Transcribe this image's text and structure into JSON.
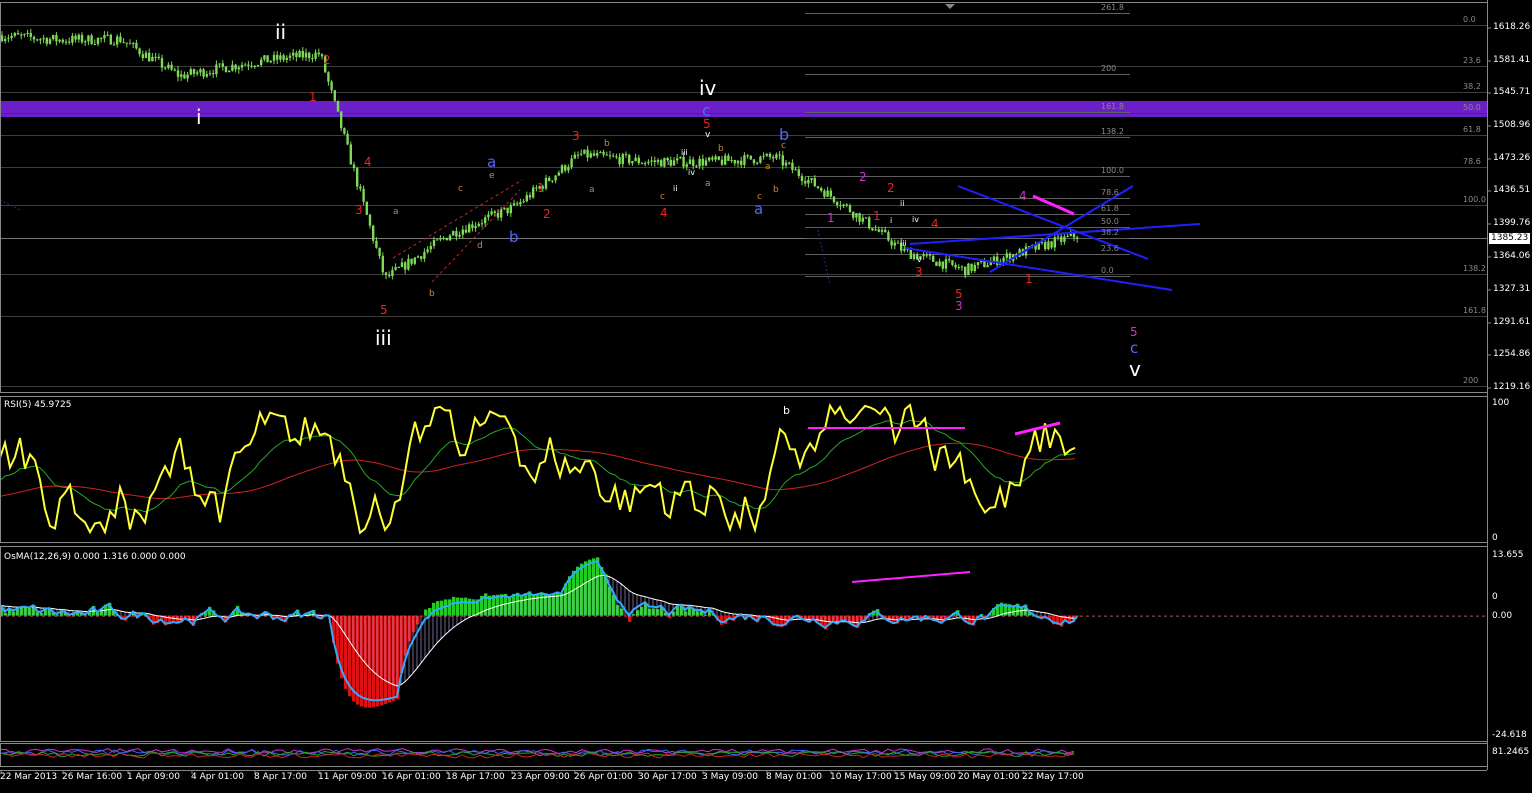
{
  "colors": {
    "background": "#000000",
    "grid": "#3a3a3a",
    "candle": "#7ed957",
    "purple_band": "#6a1fc9",
    "fib": "#606060",
    "trend": "#2020ff",
    "rsi": "#ffff33",
    "rsi_ma_fast": "#22aa22",
    "rsi_ma_slow": "#cc2222",
    "osma_pos": "#22cc22",
    "osma_neg": "#dd1111",
    "osma_line": "#33aaff",
    "osma_signal": "#ffffff",
    "divergence": "#ff22ff",
    "wave_red": "#ee2222",
    "wave_orange": "#cc8833",
    "wave_blue": "#5566ff",
    "wave_magenta": "#cc33cc",
    "wave_white": "#ffffff"
  },
  "price_panel": {
    "current_price": "1385.23",
    "y_ticks": [
      "1618.26",
      "1581.41",
      "1545.71",
      "1508.96",
      "1473.26",
      "1436.51",
      "1399.76",
      "1364.06",
      "1327.31",
      "1291.61",
      "1254.86",
      "1219.16"
    ],
    "fib_labels_right": [
      "0.0",
      "23.6",
      "38.2",
      "50.0",
      "61.8",
      "78.6",
      "100.0",
      "138.2",
      "161.8",
      "200"
    ],
    "fib_labels_inner": [
      "261.8",
      "200",
      "161.8",
      "138.2",
      "100.0",
      "78.6",
      "61.8",
      "50.0",
      "38.2",
      "23.6",
      "0.0"
    ],
    "wave_labels": [
      {
        "t": "ii",
        "c": "white"
      },
      {
        "t": "i",
        "c": "white"
      },
      {
        "t": "2",
        "c": "red"
      },
      {
        "t": "1",
        "c": "red"
      },
      {
        "t": "4",
        "c": "red"
      },
      {
        "t": "3",
        "c": "red"
      },
      {
        "t": "5",
        "c": "red"
      },
      {
        "t": "iii",
        "c": "white"
      },
      {
        "t": "a",
        "c": "blue"
      },
      {
        "t": "b",
        "c": "blue"
      },
      {
        "t": "c",
        "c": "orange"
      },
      {
        "t": "e",
        "c": "orange"
      },
      {
        "t": "d",
        "c": "orange"
      },
      {
        "t": "b",
        "c": "orange"
      },
      {
        "t": "a",
        "c": "orange"
      },
      {
        "t": "1",
        "c": "red"
      },
      {
        "t": "2",
        "c": "red"
      },
      {
        "t": "3",
        "c": "red"
      },
      {
        "t": "b",
        "c": "orange"
      },
      {
        "t": "a",
        "c": "orange"
      },
      {
        "t": "c",
        "c": "orange"
      },
      {
        "t": "4",
        "c": "red"
      },
      {
        "t": "iv",
        "c": "white"
      },
      {
        "t": "c",
        "c": "blue"
      },
      {
        "t": "5",
        "c": "red"
      },
      {
        "t": "v",
        "c": "white"
      },
      {
        "t": "b",
        "c": "orange"
      },
      {
        "t": "a",
        "c": "orange"
      },
      {
        "t": "iii",
        "c": "white"
      },
      {
        "t": "i",
        "c": "white"
      },
      {
        "t": "ii",
        "c": "white"
      },
      {
        "t": "iv",
        "c": "white"
      },
      {
        "t": "b",
        "c": "blue"
      },
      {
        "t": "c",
        "c": "orange"
      },
      {
        "t": "a",
        "c": "orange"
      },
      {
        "t": "b",
        "c": "orange"
      },
      {
        "t": "c",
        "c": "orange"
      },
      {
        "t": "a",
        "c": "blue"
      },
      {
        "t": "2",
        "c": "magenta"
      },
      {
        "t": "1",
        "c": "magenta"
      },
      {
        "t": "2",
        "c": "red"
      },
      {
        "t": "1",
        "c": "red"
      },
      {
        "t": "ii",
        "c": "white"
      },
      {
        "t": "i",
        "c": "white"
      },
      {
        "t": "iv",
        "c": "white"
      },
      {
        "t": "iii",
        "c": "white"
      },
      {
        "t": "v",
        "c": "white"
      },
      {
        "t": "4",
        "c": "red"
      },
      {
        "t": "3",
        "c": "red"
      },
      {
        "t": "5",
        "c": "red"
      },
      {
        "t": "3",
        "c": "magenta"
      },
      {
        "t": "4",
        "c": "magenta"
      },
      {
        "t": "1",
        "c": "red"
      },
      {
        "t": "5",
        "c": "magenta"
      },
      {
        "t": "c",
        "c": "blue"
      },
      {
        "t": "v",
        "c": "white"
      }
    ]
  },
  "rsi_panel": {
    "title": "RSI(5) 45.9725",
    "ticks": [
      "100",
      "0"
    ],
    "annotation": "b"
  },
  "osma_panel": {
    "title": "OsMA(12,26,9) 0.000 1.316 0.000 0.000",
    "ticks": [
      "13.655",
      "0",
      "0.00",
      "-24.618"
    ]
  },
  "bottom_panel": {
    "value": "81.2465"
  },
  "x_labels": [
    "22 Mar 2013",
    "26 Mar 16:00",
    "1 Apr 09:00",
    "4 Apr 01:00",
    "8 Apr 17:00",
    "11 Apr 09:00",
    "16 Apr 01:00",
    "18 Apr 17:00",
    "23 Apr 09:00",
    "26 Apr 01:00",
    "30 Apr 17:00",
    "3 May 09:00",
    "8 May 01:00",
    "10 May 17:00",
    "15 May 09:00",
    "20 May 01:00",
    "22 May 17:00"
  ],
  "chart_data": {
    "type": "line",
    "title": "",
    "xlabel": "",
    "ylabel": "",
    "ylim": [
      1219.16,
      1618.26
    ],
    "x": [
      "22 Mar 2013",
      "26 Mar 16:00",
      "1 Apr 09:00",
      "4 Apr 01:00",
      "8 Apr 17:00",
      "11 Apr 09:00",
      "16 Apr 01:00",
      "18 Apr 17:00",
      "23 Apr 09:00",
      "26 Apr 01:00",
      "30 Apr 17:00",
      "3 May 09:00",
      "8 May 01:00",
      "10 May 17:00",
      "15 May 09:00",
      "20 May 01:00",
      "22 May 17:00"
    ],
    "series": [
      {
        "values": [
          1610,
          1605,
          1606,
          1565,
          1580,
          1590,
          1340,
          1390,
          1420,
          1478,
          1470,
          1470,
          1475,
          1425,
          1370,
          1350,
          1388
        ]
      }
    ],
    "rsi": {
      "ylim": [
        0,
        100
      ],
      "current": 45.9725
    },
    "osma": {
      "ylim": [
        -24.618,
        13.655
      ]
    }
  }
}
